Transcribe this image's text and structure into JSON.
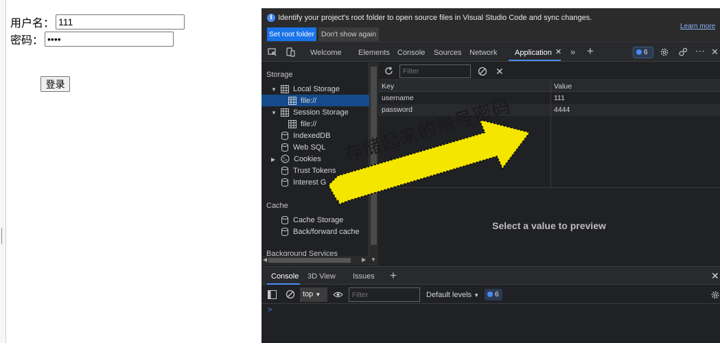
{
  "login_form": {
    "username_label": "用户名：",
    "username_value": "111",
    "password_label": "密码：",
    "password_value": "4444",
    "login_label": "登录"
  },
  "infobar": {
    "message": "Identify your project's root folder to open source files in Visual Studio Code and sync changes.",
    "set_root_label": "Set root folder",
    "dont_show_label": "Don't show again",
    "learn_more_label": "Learn more"
  },
  "tabs": [
    "Welcome",
    "Elements",
    "Console",
    "Sources",
    "Network",
    "Application"
  ],
  "issues_count": "6",
  "sidebar": {
    "storage_header": "Storage",
    "local_storage": "Local Storage",
    "local_storage_origin": "file://",
    "session_storage": "Session Storage",
    "session_storage_origin": "file://",
    "indexeddb": "IndexedDB",
    "websql": "Web SQL",
    "cookies": "Cookies",
    "trust_tokens": "Trust Tokens",
    "interest_groups": "Interest G",
    "cache_header": "Cache",
    "cache_storage": "Cache Storage",
    "bfcache": "Back/forward cache",
    "background_services": "Background Services"
  },
  "storage": {
    "filter_placeholder": "Filter",
    "key_header": "Key",
    "value_header": "Value",
    "rows": [
      {
        "key": "username",
        "value": "111"
      },
      {
        "key": "password",
        "value": "4444"
      }
    ],
    "preview_text": "Select a value to preview"
  },
  "drawer": {
    "tabs": [
      "Console",
      "3D View",
      "Issues"
    ],
    "context": "top",
    "filter_placeholder": "Filter",
    "levels": "Default levels",
    "badge_count": "6",
    "prompt": ">"
  },
  "annotation": {
    "text": "存储起来的账号密码",
    "color": "#f5e600"
  }
}
